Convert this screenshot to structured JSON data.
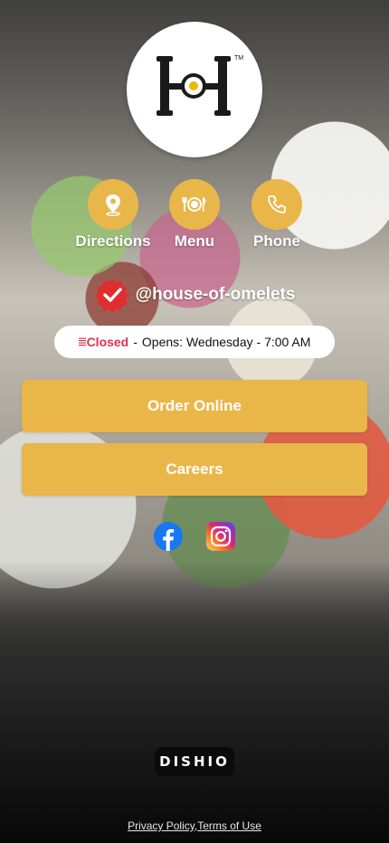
{
  "brand": {
    "logo_alt": "House of Omelets logo",
    "logo_mark": "TM"
  },
  "actions": [
    {
      "label": "Directions",
      "icon": "map-pin-icon"
    },
    {
      "label": "Menu",
      "icon": "plate-utensils-icon"
    },
    {
      "label": "Phone",
      "icon": "phone-icon"
    }
  ],
  "handle": "@house-of-omelets",
  "status": {
    "state": "Closed",
    "separator": "-",
    "next_open": "Opens: Wednesday - 7:00 AM"
  },
  "buttons": {
    "order_online": "Order Online",
    "careers": "Careers"
  },
  "social": [
    {
      "name": "facebook",
      "icon": "facebook-icon"
    },
    {
      "name": "instagram",
      "icon": "instagram-icon"
    }
  ],
  "footer": {
    "powered_by": "DISHIO",
    "privacy": "Privacy Policy",
    "separator": ",",
    "terms": "Terms of Use"
  },
  "colors": {
    "accent": "#e9b64a",
    "closed": "#e0334e",
    "badge": "#e02d2d",
    "facebook": "#1877f2"
  }
}
